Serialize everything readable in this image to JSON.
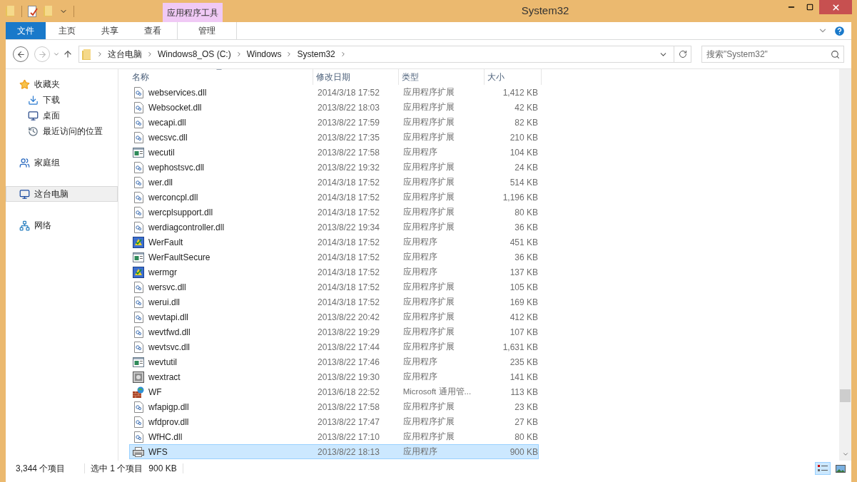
{
  "window": {
    "title": "System32",
    "context_tab_group": "应用程序工具"
  },
  "ribbon_tabs": [
    {
      "label": "文件",
      "kind": "file",
      "selected": false
    },
    {
      "label": "主页",
      "kind": "tab",
      "selected": false
    },
    {
      "label": "共享",
      "kind": "tab",
      "selected": false
    },
    {
      "label": "查看",
      "kind": "tab",
      "selected": false
    },
    {
      "label": "管理",
      "kind": "context",
      "selected": false
    }
  ],
  "address": {
    "crumbs": [
      "这台电脑",
      "Windows8_OS (C:)",
      "Windows",
      "System32"
    ]
  },
  "search": {
    "placeholder": "搜索\"System32\""
  },
  "sidebar": {
    "items": [
      {
        "label": "收藏夹",
        "kind": "star",
        "selected": false,
        "children": [
          {
            "label": "下载",
            "kind": "download",
            "selected": false
          },
          {
            "label": "桌面",
            "kind": "desktop",
            "selected": false
          },
          {
            "label": "最近访问的位置",
            "kind": "recent",
            "selected": false
          }
        ]
      },
      {
        "label": "家庭组",
        "kind": "homegroup",
        "selected": false
      },
      {
        "label": "这台电脑",
        "kind": "computer",
        "selected": true
      },
      {
        "label": "网络",
        "kind": "network",
        "selected": false
      }
    ]
  },
  "table": {
    "columns": [
      "名称",
      "修改日期",
      "类型",
      "大小"
    ],
    "rows": [
      {
        "kind": "dll",
        "name": "webservices.dll",
        "date": "2014/3/18 17:52",
        "type": "应用程序扩展",
        "size": "1,412 KB",
        "selected": false
      },
      {
        "kind": "dll",
        "name": "Websocket.dll",
        "date": "2013/8/22 18:03",
        "type": "应用程序扩展",
        "size": "42 KB",
        "selected": false
      },
      {
        "kind": "dll",
        "name": "wecapi.dll",
        "date": "2013/8/22 17:59",
        "type": "应用程序扩展",
        "size": "82 KB",
        "selected": false
      },
      {
        "kind": "dll",
        "name": "wecsvc.dll",
        "date": "2013/8/22 17:35",
        "type": "应用程序扩展",
        "size": "210 KB",
        "selected": false
      },
      {
        "kind": "console",
        "name": "wecutil",
        "date": "2013/8/22 17:58",
        "type": "应用程序",
        "size": "104 KB",
        "selected": false
      },
      {
        "kind": "dll",
        "name": "wephostsvc.dll",
        "date": "2013/8/22 19:32",
        "type": "应用程序扩展",
        "size": "24 KB",
        "selected": false
      },
      {
        "kind": "dll",
        "name": "wer.dll",
        "date": "2014/3/18 17:52",
        "type": "应用程序扩展",
        "size": "514 KB",
        "selected": false
      },
      {
        "kind": "dll",
        "name": "werconcpl.dll",
        "date": "2014/3/18 17:52",
        "type": "应用程序扩展",
        "size": "1,196 KB",
        "selected": false
      },
      {
        "kind": "dll",
        "name": "wercplsupport.dll",
        "date": "2014/3/18 17:52",
        "type": "应用程序扩展",
        "size": "80 KB",
        "selected": false
      },
      {
        "kind": "dll",
        "name": "werdiagcontroller.dll",
        "date": "2013/8/22 19:34",
        "type": "应用程序扩展",
        "size": "36 KB",
        "selected": false
      },
      {
        "kind": "warning",
        "name": "WerFault",
        "date": "2014/3/18 17:52",
        "type": "应用程序",
        "size": "451 KB",
        "selected": false
      },
      {
        "kind": "console",
        "name": "WerFaultSecure",
        "date": "2014/3/18 17:52",
        "type": "应用程序",
        "size": "36 KB",
        "selected": false
      },
      {
        "kind": "warning",
        "name": "wermgr",
        "date": "2014/3/18 17:52",
        "type": "应用程序",
        "size": "137 KB",
        "selected": false
      },
      {
        "kind": "dll",
        "name": "wersvc.dll",
        "date": "2014/3/18 17:52",
        "type": "应用程序扩展",
        "size": "105 KB",
        "selected": false
      },
      {
        "kind": "dll",
        "name": "werui.dll",
        "date": "2014/3/18 17:52",
        "type": "应用程序扩展",
        "size": "169 KB",
        "selected": false
      },
      {
        "kind": "dll",
        "name": "wevtapi.dll",
        "date": "2013/8/22 20:42",
        "type": "应用程序扩展",
        "size": "412 KB",
        "selected": false
      },
      {
        "kind": "dll",
        "name": "wevtfwd.dll",
        "date": "2013/8/22 19:29",
        "type": "应用程序扩展",
        "size": "107 KB",
        "selected": false
      },
      {
        "kind": "dll",
        "name": "wevtsvc.dll",
        "date": "2013/8/22 17:44",
        "type": "应用程序扩展",
        "size": "1,631 KB",
        "selected": false
      },
      {
        "kind": "console",
        "name": "wevtutil",
        "date": "2013/8/22 17:46",
        "type": "应用程序",
        "size": "235 KB",
        "selected": false
      },
      {
        "kind": "installer",
        "name": "wextract",
        "date": "2013/8/22 19:30",
        "type": "应用程序",
        "size": "141 KB",
        "selected": false
      },
      {
        "kind": "firewall",
        "name": "WF",
        "date": "2013/6/18 22:52",
        "type": "Microsoft 通用管...",
        "size": "113 KB",
        "selected": false
      },
      {
        "kind": "dll",
        "name": "wfapigp.dll",
        "date": "2013/8/22 17:58",
        "type": "应用程序扩展",
        "size": "23 KB",
        "selected": false
      },
      {
        "kind": "dll",
        "name": "wfdprov.dll",
        "date": "2013/8/22 17:47",
        "type": "应用程序扩展",
        "size": "27 KB",
        "selected": false
      },
      {
        "kind": "dll",
        "name": "WfHC.dll",
        "date": "2013/8/22 17:10",
        "type": "应用程序扩展",
        "size": "80 KB",
        "selected": false
      },
      {
        "kind": "printer",
        "name": "WFS",
        "date": "2013/8/22 18:13",
        "type": "应用程序",
        "size": "900 KB",
        "selected": true
      }
    ]
  },
  "status_bar": {
    "item_count": "3,344 个项目",
    "selection": "选中 1 个项目",
    "selection_size": "900 KB"
  },
  "view_buttons": [
    {
      "kind": "details",
      "selected": true
    },
    {
      "kind": "thumbnails",
      "selected": false
    }
  ]
}
